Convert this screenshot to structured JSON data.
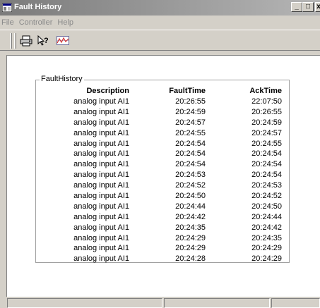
{
  "window": {
    "title": "Fault History",
    "controls": {
      "minimize": "_",
      "maximize": "□",
      "close": "x"
    }
  },
  "menu": [
    {
      "label": "File"
    },
    {
      "label": "Controller"
    },
    {
      "label": "Help"
    }
  ],
  "toolbar": {
    "icons": [
      "printer-icon",
      "context-help-icon",
      "trend-chart-icon"
    ]
  },
  "fault_history": {
    "group_label": "FaultHistory",
    "columns": {
      "description": "Description",
      "fault_time": "FaultTime",
      "ack_time": "AckTime"
    },
    "rows": [
      {
        "description": "analog input AI1",
        "fault_time": "20:26:55",
        "ack_time": "22:07:50"
      },
      {
        "description": "analog input AI1",
        "fault_time": "20:24:59",
        "ack_time": "20:26:55"
      },
      {
        "description": "analog input AI1",
        "fault_time": "20:24:57",
        "ack_time": "20:24:59"
      },
      {
        "description": "analog input AI1",
        "fault_time": "20:24:55",
        "ack_time": "20:24:57"
      },
      {
        "description": "analog input AI1",
        "fault_time": "20:24:54",
        "ack_time": "20:24:55"
      },
      {
        "description": "analog input AI1",
        "fault_time": "20:24:54",
        "ack_time": "20:24:54"
      },
      {
        "description": "analog input AI1",
        "fault_time": "20:24:54",
        "ack_time": "20:24:54"
      },
      {
        "description": "analog input AI1",
        "fault_time": "20:24:53",
        "ack_time": "20:24:54"
      },
      {
        "description": "analog input AI1",
        "fault_time": "20:24:52",
        "ack_time": "20:24:53"
      },
      {
        "description": "analog input AI1",
        "fault_time": "20:24:50",
        "ack_time": "20:24:52"
      },
      {
        "description": "analog input AI1",
        "fault_time": "20:24:44",
        "ack_time": "20:24:50"
      },
      {
        "description": "analog input AI1",
        "fault_time": "20:24:42",
        "ack_time": "20:24:44"
      },
      {
        "description": "analog input AI1",
        "fault_time": "20:24:35",
        "ack_time": "20:24:42"
      },
      {
        "description": "analog input AI1",
        "fault_time": "20:24:29",
        "ack_time": "20:24:35"
      },
      {
        "description": "analog input AI1",
        "fault_time": "20:24:29",
        "ack_time": "20:24:29"
      },
      {
        "description": "analog input AI1",
        "fault_time": "20:24:28",
        "ack_time": "20:24:29"
      }
    ]
  },
  "colors": {
    "title_gradient_start": "#7b7b7b",
    "title_gradient_end": "#b5b5b5",
    "window_face": "#d4d0c8",
    "disabled_menu_text": "#8a8a8a"
  }
}
